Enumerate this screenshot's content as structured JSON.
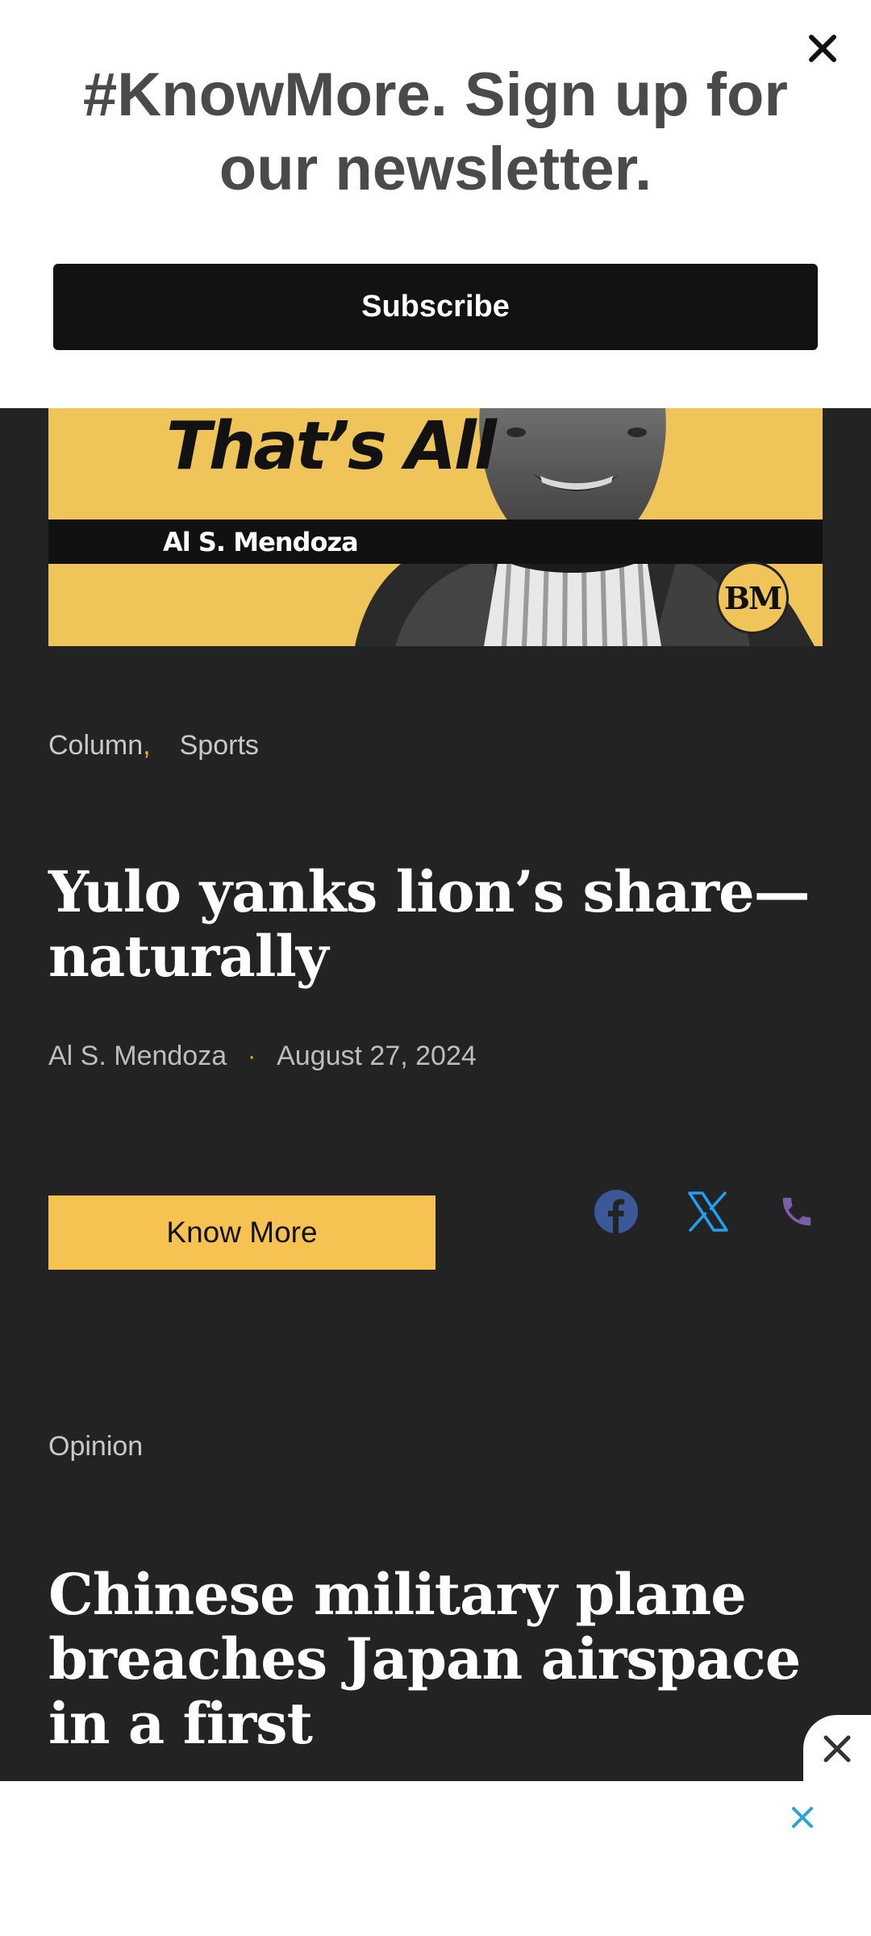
{
  "newsletter": {
    "title": "#KnowMore. Sign up for our newsletter.",
    "subscribe_label": "Subscribe",
    "close_icon": "close-icon"
  },
  "hero": {
    "column_title": "That’s All",
    "author": "Al S. Mendoza",
    "badge": "BM",
    "background_color": "#efc458"
  },
  "article": {
    "categories": [
      "Column",
      "Sports"
    ],
    "category_separator": ",",
    "title": "Yulo yanks lion’s share—naturally",
    "author": "Al S. Mendoza",
    "dot": "·",
    "date": "August 27, 2024",
    "know_more_label": "Know More",
    "share_icons": [
      "facebook-icon",
      "x-icon",
      "phone-icon"
    ]
  },
  "next_article": {
    "section": "Opinion",
    "title": "Chinese military plane breaches Japan airspace in a first"
  },
  "colors": {
    "background": "#232323",
    "accent": "#f6c352",
    "facebook": "#3b5998",
    "x": "#1da1f2",
    "phone": "#7b5ea7",
    "ad_close": "#26a6d1"
  }
}
